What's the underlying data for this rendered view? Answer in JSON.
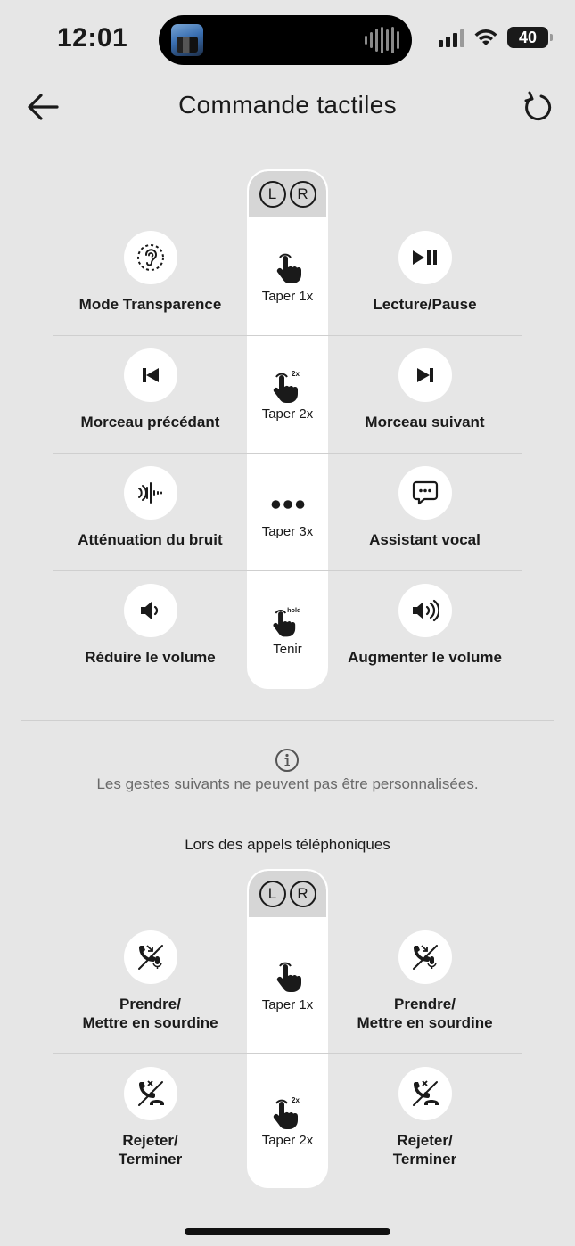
{
  "status": {
    "time": "12:01",
    "battery": "40"
  },
  "header": {
    "title": "Commande tactiles"
  },
  "lr": {
    "left": "L",
    "right": "R"
  },
  "gestures": [
    {
      "gesture": "Taper 1x",
      "badge": "",
      "left": "Mode Transparence",
      "left_icon": "ear-icon",
      "right": "Lecture/Pause",
      "right_icon": "play-pause-icon"
    },
    {
      "gesture": "Taper 2x",
      "badge": "2x",
      "left": "Morceau précédant",
      "left_icon": "previous-track-icon",
      "right": "Morceau suivant",
      "right_icon": "next-track-icon"
    },
    {
      "gesture": "Taper 3x",
      "badge": "",
      "left": "Atténuation du bruit",
      "left_icon": "noise-cancel-icon",
      "right": "Assistant vocal",
      "right_icon": "voice-assistant-icon"
    },
    {
      "gesture": "Tenir",
      "badge": "hold",
      "left": "Réduire le volume",
      "left_icon": "volume-down-icon",
      "right": "Augmenter le volume",
      "right_icon": "volume-up-icon"
    }
  ],
  "info": {
    "text": "Les gestes suivants ne peuvent pas être personnalisées."
  },
  "calls": {
    "title": "Lors des appels téléphoniques",
    "rows": [
      {
        "gesture": "Taper 1x",
        "badge": "",
        "left_line1": "Prendre/",
        "left_line2": "Mettre en sourdine",
        "right_line1": "Prendre/",
        "right_line2": "Mettre en sourdine"
      },
      {
        "gesture": "Taper 2x",
        "badge": "2x",
        "left_line1": "Rejeter/",
        "left_line2": "Terminer",
        "right_line1": "Rejeter/",
        "right_line2": "Terminer"
      }
    ]
  }
}
